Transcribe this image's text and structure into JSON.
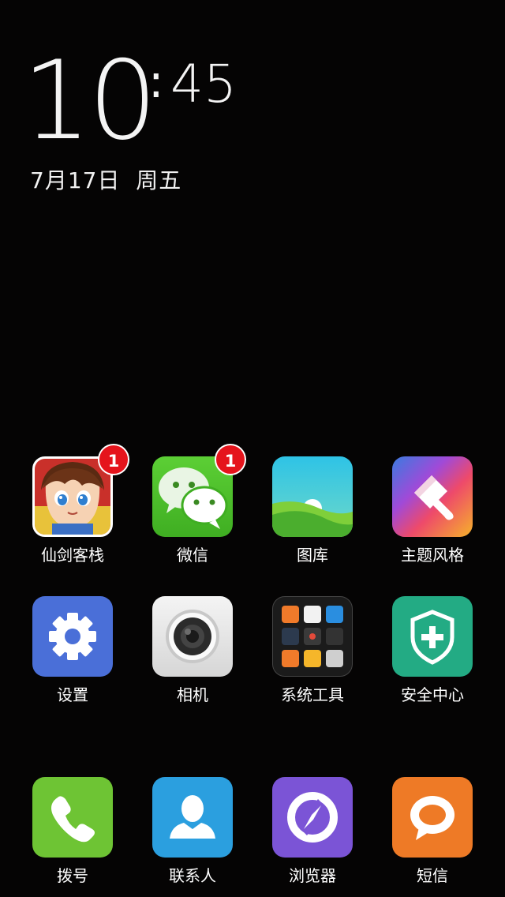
{
  "clock": {
    "hour": "10",
    "separator": ":",
    "minute": "45"
  },
  "date": "7月17日  周五",
  "apps": [
    {
      "label": "仙剑客栈",
      "badge": "1"
    },
    {
      "label": "微信",
      "badge": "1"
    },
    {
      "label": "图库"
    },
    {
      "label": "主题风格"
    },
    {
      "label": "设置"
    },
    {
      "label": "相机"
    },
    {
      "label": "系统工具"
    },
    {
      "label": "安全中心"
    }
  ],
  "dock": [
    {
      "label": "拨号"
    },
    {
      "label": "联系人"
    },
    {
      "label": "浏览器"
    },
    {
      "label": "短信"
    }
  ],
  "icons": {
    "game": "xianjian-game-icon",
    "wechat": "wechat-icon",
    "gallery": "gallery-icon",
    "theme": "brush-icon",
    "settings": "gear-icon",
    "camera": "camera-icon",
    "tools": "folder-icon",
    "security": "shield-plus-icon",
    "phone": "phone-icon",
    "contacts": "person-icon",
    "browser": "browser-icon",
    "sms": "chat-bubble-icon"
  },
  "colors": {
    "background": "#050404",
    "badge": "#e5141c",
    "settings": "#4a6fd8",
    "security": "#23ab84",
    "phone": "#6ec434",
    "contacts": "#2b9fdf",
    "browser": "#7b54d6",
    "sms": "#ee7a26"
  }
}
